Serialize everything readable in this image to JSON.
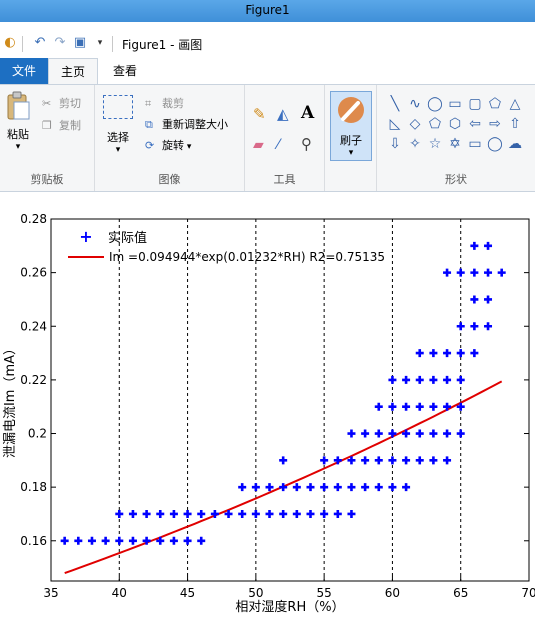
{
  "window": {
    "title": "Figure1"
  },
  "qat": {
    "document_title": "Figure1 - 画图"
  },
  "tabs": {
    "file": "文件",
    "home": "主页",
    "view": "查看"
  },
  "ribbon": {
    "clipboard": {
      "paste": "粘贴",
      "cut": "剪切",
      "copy": "复制",
      "group": "剪贴板"
    },
    "image": {
      "select": "选择",
      "crop": "裁剪",
      "resize": "重新调整大小",
      "rotate": "旋转",
      "group": "图像"
    },
    "tools": {
      "group": "工具",
      "text_tool": "A"
    },
    "brushes": {
      "label": "刷子"
    },
    "shapes": {
      "group": "形状"
    }
  },
  "chart_data": {
    "type": "scatter",
    "xlabel": "相对湿度RH（%）",
    "ylabel": "泄漏电流Im（mA）",
    "xlim": [
      35,
      70
    ],
    "ylim": [
      0.145,
      0.28
    ],
    "xticks": [
      "35",
      "40",
      "45",
      "50",
      "55",
      "60",
      "65",
      "70"
    ],
    "yticks": [
      "0.16",
      "0.18",
      "0.2",
      "0.22",
      "0.24",
      "0.26",
      "0.28"
    ],
    "legend": {
      "placement": "top-left",
      "points_label": "实际值",
      "fit_label": "Im =0.094944*exp(0.01232*RH) R2=0.75135"
    },
    "grid": "vertical-dashed",
    "series": [
      {
        "name": "实际值",
        "kind": "points",
        "color": "#0000ff",
        "points": [
          [
            36,
            0.16
          ],
          [
            37,
            0.16
          ],
          [
            38,
            0.16
          ],
          [
            39,
            0.16
          ],
          [
            40,
            0.16
          ],
          [
            41,
            0.16
          ],
          [
            42,
            0.16
          ],
          [
            43,
            0.16
          ],
          [
            44,
            0.16
          ],
          [
            45,
            0.16
          ],
          [
            46,
            0.16
          ],
          [
            40,
            0.17
          ],
          [
            41,
            0.17
          ],
          [
            42,
            0.17
          ],
          [
            43,
            0.17
          ],
          [
            44,
            0.17
          ],
          [
            45,
            0.17
          ],
          [
            46,
            0.17
          ],
          [
            47,
            0.17
          ],
          [
            48,
            0.17
          ],
          [
            49,
            0.17
          ],
          [
            50,
            0.17
          ],
          [
            51,
            0.17
          ],
          [
            52,
            0.17
          ],
          [
            53,
            0.17
          ],
          [
            54,
            0.17
          ],
          [
            55,
            0.17
          ],
          [
            56,
            0.17
          ],
          [
            57,
            0.17
          ],
          [
            49,
            0.18
          ],
          [
            50,
            0.18
          ],
          [
            51,
            0.18
          ],
          [
            52,
            0.18
          ],
          [
            53,
            0.18
          ],
          [
            54,
            0.18
          ],
          [
            55,
            0.18
          ],
          [
            56,
            0.18
          ],
          [
            57,
            0.18
          ],
          [
            58,
            0.18
          ],
          [
            59,
            0.18
          ],
          [
            60,
            0.18
          ],
          [
            61,
            0.18
          ],
          [
            52,
            0.19
          ],
          [
            55,
            0.19
          ],
          [
            56,
            0.19
          ],
          [
            57,
            0.19
          ],
          [
            58,
            0.19
          ],
          [
            59,
            0.19
          ],
          [
            60,
            0.19
          ],
          [
            61,
            0.19
          ],
          [
            62,
            0.19
          ],
          [
            63,
            0.19
          ],
          [
            64,
            0.19
          ],
          [
            57,
            0.2
          ],
          [
            58,
            0.2
          ],
          [
            59,
            0.2
          ],
          [
            60,
            0.2
          ],
          [
            61,
            0.2
          ],
          [
            62,
            0.2
          ],
          [
            63,
            0.2
          ],
          [
            64,
            0.2
          ],
          [
            65,
            0.2
          ],
          [
            59,
            0.21
          ],
          [
            60,
            0.21
          ],
          [
            61,
            0.21
          ],
          [
            62,
            0.21
          ],
          [
            63,
            0.21
          ],
          [
            64,
            0.21
          ],
          [
            65,
            0.21
          ],
          [
            60,
            0.22
          ],
          [
            61,
            0.22
          ],
          [
            62,
            0.22
          ],
          [
            63,
            0.22
          ],
          [
            64,
            0.22
          ],
          [
            65,
            0.22
          ],
          [
            62,
            0.23
          ],
          [
            63,
            0.23
          ],
          [
            64,
            0.23
          ],
          [
            65,
            0.23
          ],
          [
            66,
            0.23
          ],
          [
            65,
            0.24
          ],
          [
            66,
            0.24
          ],
          [
            67,
            0.24
          ],
          [
            66,
            0.25
          ],
          [
            67,
            0.25
          ],
          [
            64,
            0.26
          ],
          [
            65,
            0.26
          ],
          [
            66,
            0.26
          ],
          [
            67,
            0.26
          ],
          [
            68,
            0.26
          ],
          [
            66,
            0.27
          ],
          [
            67,
            0.27
          ]
        ]
      },
      {
        "name": "Im =0.094944*exp(0.01232*RH) R2=0.75135",
        "kind": "fit",
        "color": "#e00000",
        "x_range": [
          36,
          68
        ],
        "a": 0.094944,
        "b": 0.01232
      }
    ]
  }
}
